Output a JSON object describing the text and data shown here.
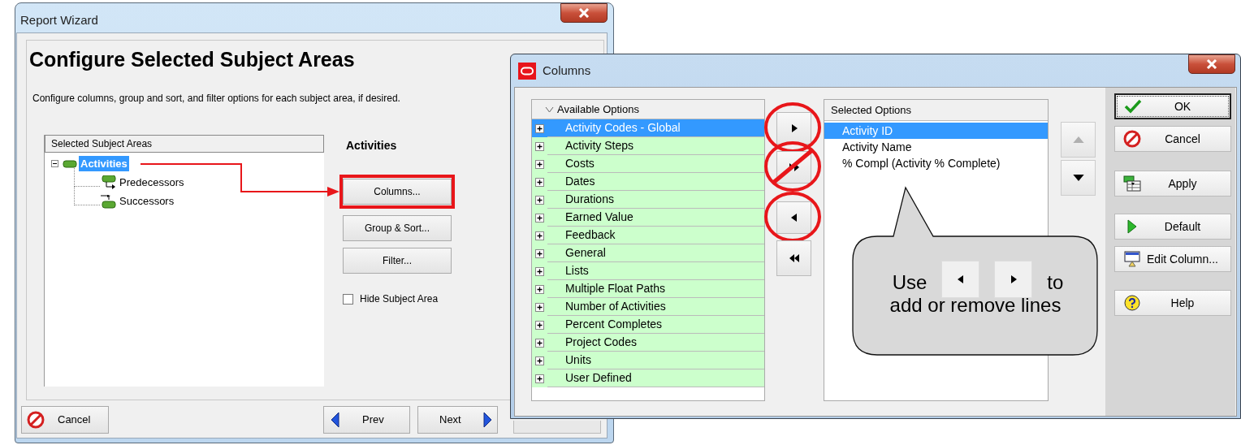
{
  "report_wizard": {
    "title": "Report Wizard",
    "heading": "Configure Selected Subject Areas",
    "description": "Configure columns, group and sort, and filter options for each subject area, if desired.",
    "tree": {
      "header": "Selected Subject Areas",
      "items": [
        {
          "label": "Activities",
          "kind": "activities",
          "selected": true,
          "expanded": true,
          "children": [
            {
              "label": "Predecessors",
              "kind": "predecessors",
              "selected": false
            },
            {
              "label": "Successors",
              "kind": "successors",
              "selected": false
            }
          ]
        }
      ]
    },
    "subject_title": "Activities",
    "buttons": [
      {
        "label": "Columns...",
        "highlighted": true
      },
      {
        "label": "Group & Sort...",
        "highlighted": false
      },
      {
        "label": "Filter...",
        "highlighted": false
      }
    ],
    "hide_subject_area": {
      "label": "Hide Subject Area",
      "checked": false
    },
    "footer_buttons": [
      {
        "label": "Cancel",
        "kind": "cancel"
      },
      {
        "label": "Prev",
        "kind": "prev"
      },
      {
        "label": "Next",
        "kind": "next"
      },
      {
        "kind": "finish"
      }
    ]
  },
  "columns_dialog": {
    "title": "Columns",
    "available": {
      "header": "Available Options",
      "items": [
        {
          "label": "Activity Codes - Global",
          "selected": true
        },
        {
          "label": "Activity Steps",
          "selected": false
        },
        {
          "label": "Costs",
          "selected": false
        },
        {
          "label": "Dates",
          "selected": false
        },
        {
          "label": "Durations",
          "selected": false
        },
        {
          "label": "Earned Value",
          "selected": false
        },
        {
          "label": "Feedback",
          "selected": false
        },
        {
          "label": "General",
          "selected": false
        },
        {
          "label": "Lists",
          "selected": false
        },
        {
          "label": "Multiple Float Paths",
          "selected": false
        },
        {
          "label": "Number of Activities",
          "selected": false
        },
        {
          "label": "Percent Completes",
          "selected": false
        },
        {
          "label": "Project Codes",
          "selected": false
        },
        {
          "label": "Units",
          "selected": false
        },
        {
          "label": "User Defined",
          "selected": false
        }
      ]
    },
    "transfer_buttons": [
      {
        "kind": "add",
        "annotation": {
          "kind": "circle"
        }
      },
      {
        "kind": "add_all",
        "annotation": {
          "kind": "crossed_circle"
        }
      },
      {
        "kind": "remove",
        "annotation": {
          "kind": "circle"
        }
      },
      {
        "kind": "remove_all"
      }
    ],
    "selected": {
      "header": "Selected Options",
      "items": [
        {
          "label": "Activity ID",
          "selected": true
        },
        {
          "label": "Activity Name",
          "selected": false
        },
        {
          "label": "% Compl  (Activity % Complete)",
          "selected": false
        }
      ]
    },
    "move_buttons": [
      {
        "kind": "up",
        "disabled": true
      },
      {
        "kind": "down",
        "disabled": false
      }
    ],
    "action_buttons": [
      {
        "label": "OK",
        "kind": "ok",
        "focused": true
      },
      {
        "label": "Cancel",
        "kind": "cancel",
        "focused": false
      },
      {
        "label": "Apply",
        "kind": "apply",
        "focused": false
      },
      {
        "label": "Default",
        "kind": "default",
        "focused": false
      },
      {
        "label": "Edit Column...",
        "kind": "edit",
        "focused": false
      },
      {
        "label": "Help",
        "kind": "help",
        "focused": false
      }
    ],
    "callout": {
      "before": "Use",
      "after": "to",
      "line2": "add or remove lines",
      "buttons": [
        {
          "kind": "remove"
        },
        {
          "kind": "add"
        }
      ]
    }
  }
}
